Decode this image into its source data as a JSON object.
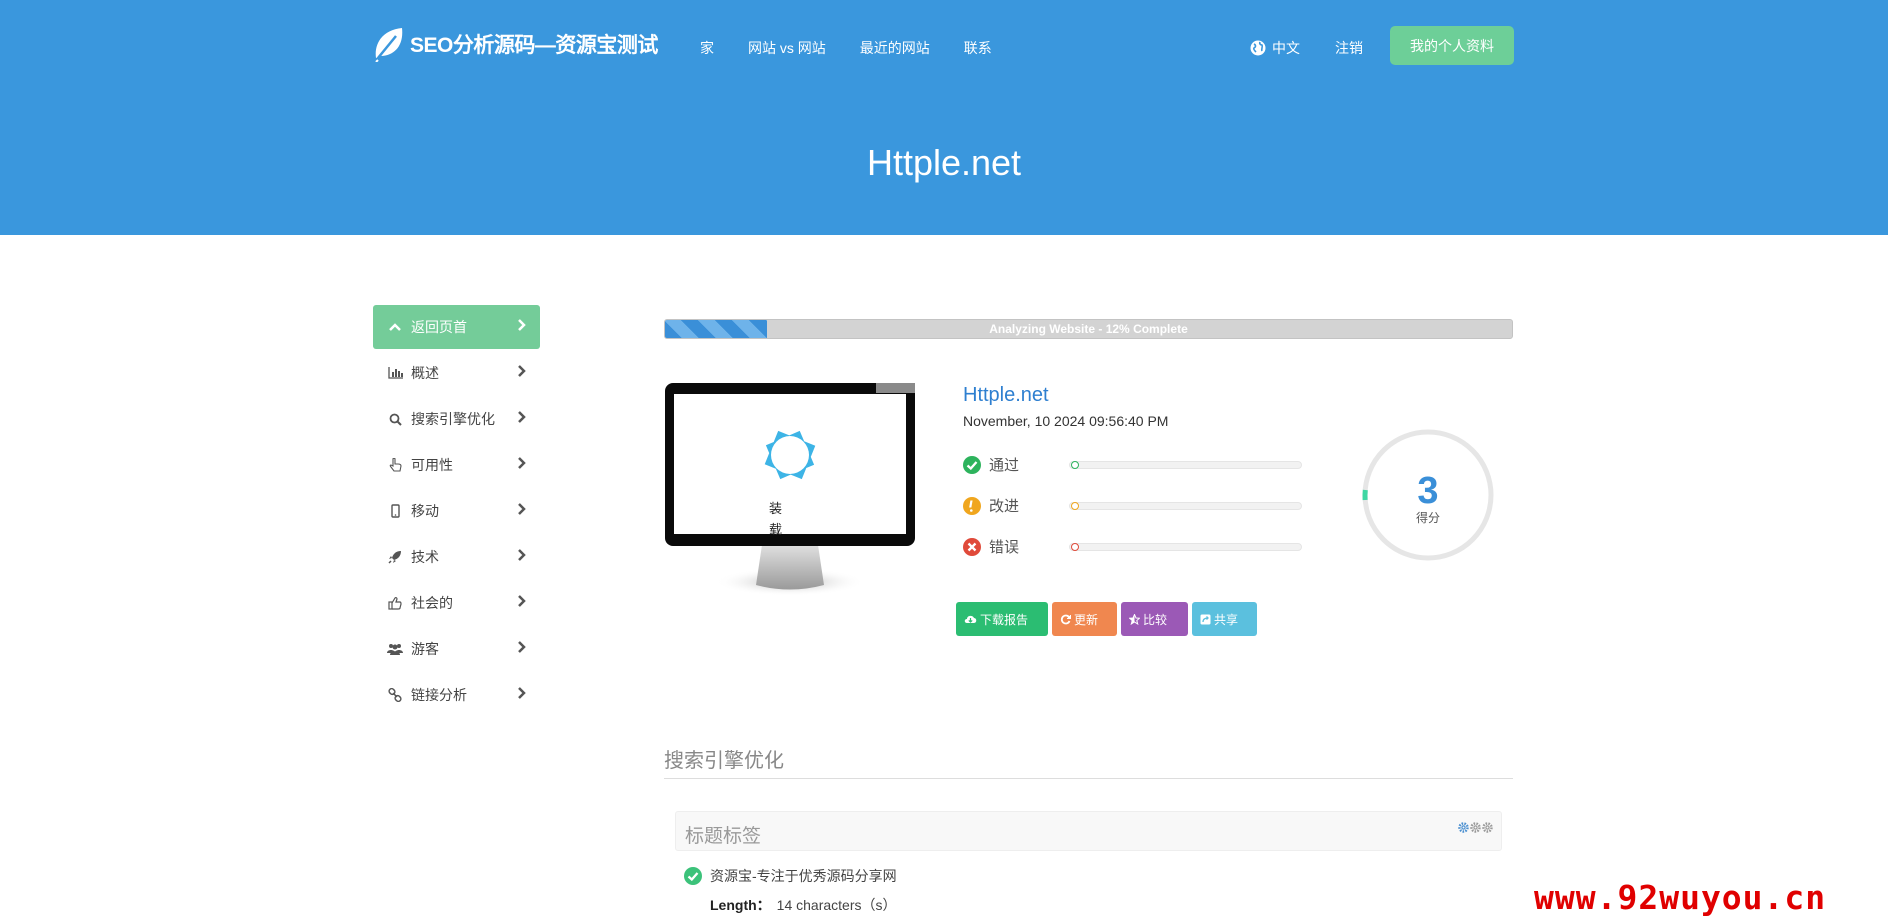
{
  "header": {
    "brand": "SEO分析源码—资源宝测试",
    "nav": [
      "家",
      "网站 vs 网站",
      "最近的网站",
      "联系"
    ],
    "language": "中文",
    "logout": "注销",
    "profile_button": "我的个人资料",
    "site_title": "Httple.net",
    "colors": {
      "header_bg": "#3a97dd",
      "profile_btn": "#6dcf98"
    }
  },
  "sidebar": {
    "items": [
      {
        "label": "返回页首",
        "icon": "chevron-up-icon",
        "active": true
      },
      {
        "label": "概述",
        "icon": "bar-chart-icon"
      },
      {
        "label": "搜索引擎优化",
        "icon": "search-icon"
      },
      {
        "label": "可用性",
        "icon": "pointer-hand-icon"
      },
      {
        "label": "移动",
        "icon": "mobile-icon"
      },
      {
        "label": "技术",
        "icon": "rocket-icon"
      },
      {
        "label": "社会的",
        "icon": "thumbs-up-icon"
      },
      {
        "label": "游客",
        "icon": "users-icon"
      },
      {
        "label": "链接分析",
        "icon": "link-icon"
      }
    ]
  },
  "progress": {
    "text": "Analyzing Website - 12% Complete",
    "percent": 12
  },
  "preview": {
    "loading_text_1": "装",
    "loading_text_2": "载"
  },
  "report": {
    "site_name": "Httple.net",
    "date": "November, 10 2024 09:56:40 PM",
    "stats": [
      {
        "label": "通过",
        "icon": "check-circle-icon",
        "color": "#2db35d"
      },
      {
        "label": "改进",
        "icon": "warning-circle-icon",
        "color": "#f0a61e"
      },
      {
        "label": "错误",
        "icon": "error-circle-icon",
        "color": "#e04a3a"
      }
    ],
    "score": "3",
    "score_label": "得分"
  },
  "actions": [
    {
      "label": "下载报告",
      "icon": "cloud-download-icon",
      "color": "#2bbd72"
    },
    {
      "label": "更新",
      "icon": "refresh-icon",
      "color": "#f0874f"
    },
    {
      "label": "比较",
      "icon": "star-half-icon",
      "color": "#9b59b6"
    },
    {
      "label": "共享",
      "icon": "share-icon",
      "color": "#5bc0de"
    }
  ],
  "seo": {
    "section_title": "搜索引擎优化",
    "panel_title": "标题标签",
    "title_value": "资源宝-专注于优秀源码分享网",
    "length_label": "Length：",
    "length_value": "14 characters（s）"
  },
  "watermark": "www.92wuyou.cn"
}
